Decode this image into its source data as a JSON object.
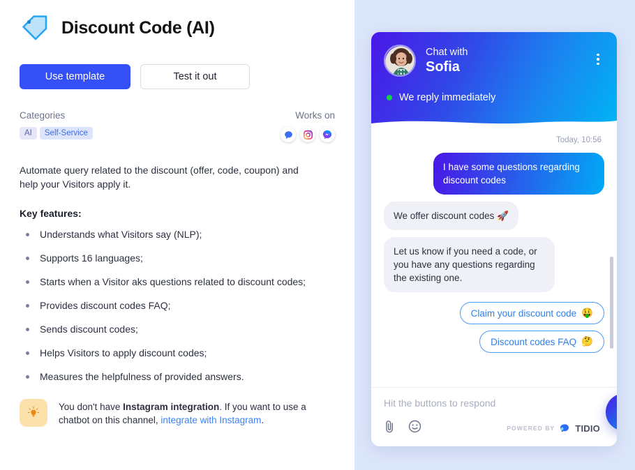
{
  "template": {
    "title": "Discount Code (AI)",
    "title_icon": "tag-icon",
    "primary_button": "Use template",
    "secondary_button": "Test it out",
    "categories_label": "Categories",
    "categories": [
      "AI",
      "Self-Service"
    ],
    "works_on_label": "Works on",
    "channels": [
      "live-chat-icon",
      "instagram-icon",
      "messenger-icon"
    ],
    "description": "Automate query related to the discount (offer, code, coupon) and help your Visitors apply it.",
    "key_features_label": "Key features:",
    "features": [
      "Understands what Visitors say (NLP);",
      "Supports 16 languages;",
      "Starts when a Visitor aks questions related to discount codes;",
      "Provides discount codes FAQ;",
      "Sends discount codes;",
      "Helps Visitors to apply discount codes;",
      "Measures the helpfulness of provided answers."
    ],
    "notice": {
      "icon": "lightbulb-icon",
      "text_before": "You don't have ",
      "text_bold": "Instagram integration",
      "text_middle": ". If you want to use a chatbot on this channel, ",
      "link": "integrate with Instagram",
      "text_after": "."
    },
    "colors": {
      "primary": "#3550f7",
      "link": "#3b82f6",
      "tag_ai_bg": "#e5e7f7",
      "tag_self_service_bg": "#dde5fd",
      "panel_bg": "#dde7fb"
    }
  },
  "widget": {
    "header": {
      "chat_with": "Chat with",
      "agent_name": "Sofia",
      "avatar": "agent-avatar",
      "menu_icon": "kebab-menu-icon",
      "status": "We reply immediately",
      "status_dot_color": "#19d04a"
    },
    "timestamp": "Today, 10:56",
    "messages": [
      {
        "from": "visitor",
        "text": "I have some questions regarding discount codes"
      },
      {
        "from": "bot",
        "text": "We offer discount codes 🚀"
      },
      {
        "from": "bot",
        "text": "Let us know if you need a code, or you have any questions regarding the existing one."
      }
    ],
    "quick_replies": [
      {
        "label": "Claim your discount code",
        "emoji": "🤑"
      },
      {
        "label": "Discount codes FAQ",
        "emoji": "🤔"
      }
    ],
    "composer_placeholder": "Hit the buttons to respond",
    "footer": {
      "attachment_icon": "paperclip-icon",
      "emoji_icon": "smiley-icon",
      "powered_by": "POWERED BY",
      "brand": "TIDIO",
      "send_icon": "send-icon"
    }
  }
}
